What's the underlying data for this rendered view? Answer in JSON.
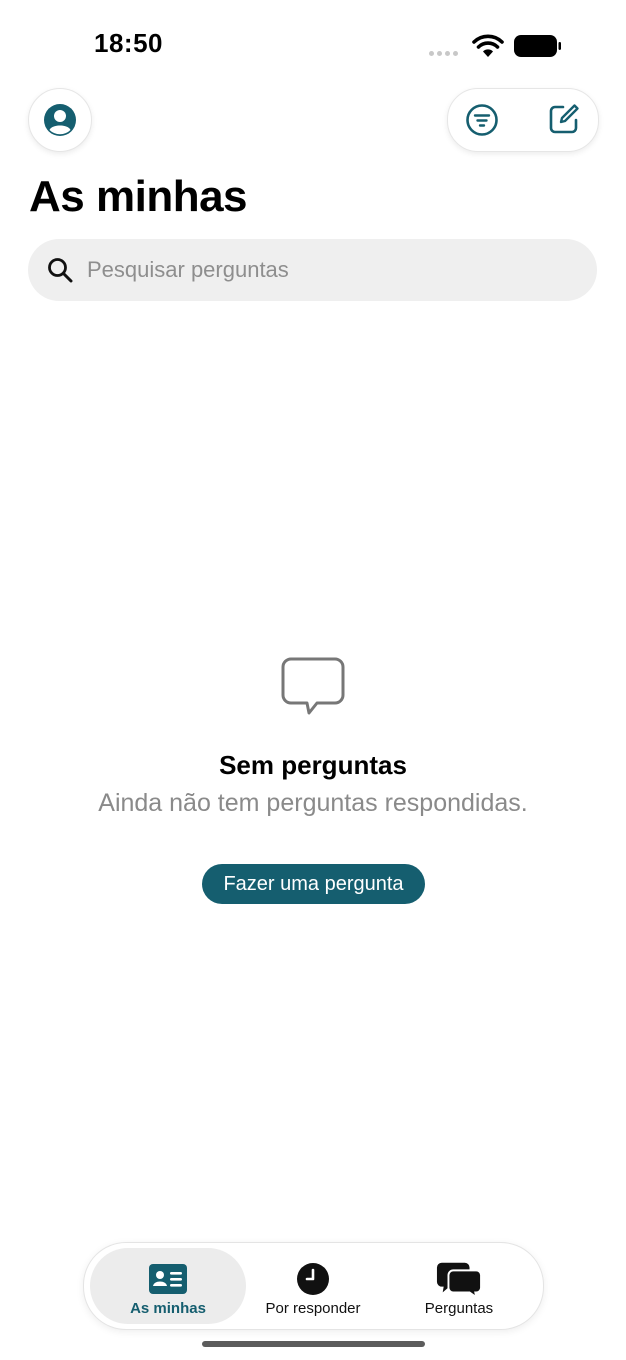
{
  "status_bar": {
    "time": "18:50"
  },
  "header": {
    "title": "As minhas"
  },
  "search": {
    "placeholder": "Pesquisar perguntas",
    "value": ""
  },
  "empty_state": {
    "title": "Sem perguntas",
    "subtitle": "Ainda não tem perguntas respondidas.",
    "button_label": "Fazer uma pergunta"
  },
  "tab_bar": {
    "tabs": [
      {
        "label": "As minhas",
        "icon": "id-card-icon",
        "active": true
      },
      {
        "label": "Por responder",
        "icon": "clock-icon",
        "active": false
      },
      {
        "label": "Perguntas",
        "icon": "chat-bubbles-icon",
        "active": false
      }
    ]
  },
  "colors": {
    "accent": "#155e6f",
    "search_bg": "#efefef",
    "muted_text": "#8a8a8a"
  }
}
